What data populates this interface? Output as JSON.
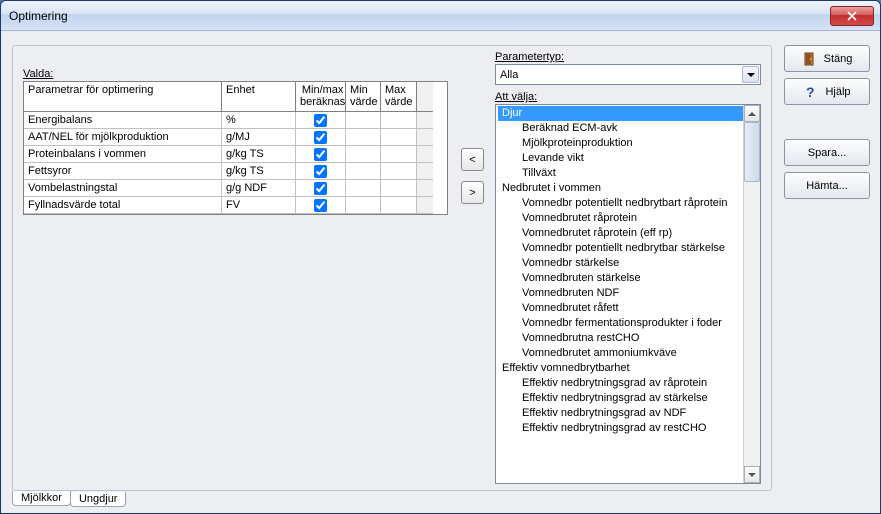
{
  "window": {
    "title": "Optimering"
  },
  "left": {
    "label": "Valda:",
    "columns": {
      "param": "Parametrar för optimering",
      "unit": "Enhet",
      "minmax": "Min/max beräknas",
      "minv": "Min värde",
      "maxv": "Max värde"
    },
    "rows": [
      {
        "param": "Energibalans",
        "unit": "%",
        "chk": true
      },
      {
        "param": "AAT/NEL för mjölkproduktion",
        "unit": "g/MJ",
        "chk": true
      },
      {
        "param": "Proteinbalans i vommen",
        "unit": "g/kg TS",
        "chk": true
      },
      {
        "param": "Fettsyror",
        "unit": "g/kg TS",
        "chk": true
      },
      {
        "param": "Vombelastningstal",
        "unit": "g/g NDF",
        "chk": true
      },
      {
        "param": "Fyllnadsvärde total",
        "unit": "FV",
        "chk": true
      }
    ]
  },
  "right": {
    "type_label": "Parametertyp:",
    "combo_value": "Alla",
    "pick_label": "Att välja:",
    "tree": [
      {
        "lvl": 0,
        "label": "Djur",
        "selected": true
      },
      {
        "lvl": 1,
        "label": "Beräknad ECM-avk"
      },
      {
        "lvl": 1,
        "label": "Mjölkproteinproduktion"
      },
      {
        "lvl": 1,
        "label": "Levande vikt"
      },
      {
        "lvl": 1,
        "label": "Tillväxt"
      },
      {
        "lvl": 0,
        "label": "Nedbrutet i vommen"
      },
      {
        "lvl": 1,
        "label": "Vomnedbr potentiellt nedbrytbart råprotein"
      },
      {
        "lvl": 1,
        "label": "Vomnedbrutet råprotein"
      },
      {
        "lvl": 1,
        "label": "Vomnedbrutet råprotein (eff rp)"
      },
      {
        "lvl": 1,
        "label": "Vomnedbr potentiellt nedbrytbar stärkelse"
      },
      {
        "lvl": 1,
        "label": "Vomnedbr stärkelse"
      },
      {
        "lvl": 1,
        "label": "Vomnedbruten stärkelse"
      },
      {
        "lvl": 1,
        "label": "Vomnedbruten NDF"
      },
      {
        "lvl": 1,
        "label": "Vomnedbrutet råfett"
      },
      {
        "lvl": 1,
        "label": "Vomnedbr fermentationsprodukter i foder"
      },
      {
        "lvl": 1,
        "label": "Vomnedbrutna restCHO"
      },
      {
        "lvl": 1,
        "label": "Vomnedbrutet ammoniumkväve"
      },
      {
        "lvl": 0,
        "label": "Effektiv vomnedbrytbarhet"
      },
      {
        "lvl": 1,
        "label": "Effektiv nedbrytningsgrad av råprotein"
      },
      {
        "lvl": 1,
        "label": "Effektiv nedbrytningsgrad av stärkelse"
      },
      {
        "lvl": 1,
        "label": "Effektiv nedbrytningsgrad av NDF"
      },
      {
        "lvl": 1,
        "label": "Effektiv nedbrytningsgrad av restCHO"
      }
    ]
  },
  "buttons": {
    "close": "Stäng",
    "help": "Hjälp",
    "save": "Spara...",
    "load": "Hämta..."
  },
  "transfer": {
    "left": "<",
    "right": ">"
  },
  "tabs": {
    "a": "Mjölkkor",
    "b": "Ungdjur"
  }
}
